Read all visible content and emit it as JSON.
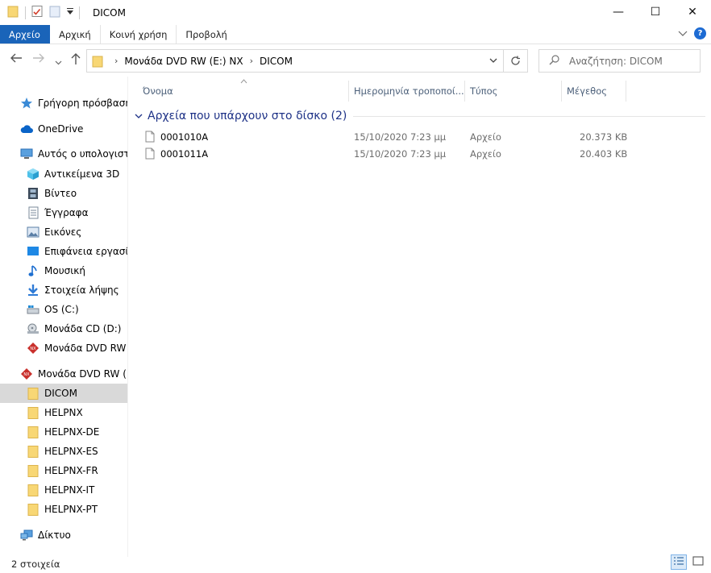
{
  "window": {
    "title": "DICOM",
    "controls": {
      "minimize": "—",
      "maximize": "☐",
      "close": "✕"
    }
  },
  "ribbon": {
    "tabs": [
      {
        "label": "Αρχείο",
        "active": true
      },
      {
        "label": "Αρχική"
      },
      {
        "label": "Κοινή χρήση"
      },
      {
        "label": "Προβολή"
      }
    ],
    "help": "?"
  },
  "nav": {
    "breadcrumb": [
      "Μονάδα DVD RW (E:) NX",
      "DICOM"
    ],
    "search_placeholder": "Αναζήτηση: DICOM"
  },
  "sidebar": {
    "items": [
      {
        "label": "Γρήγορη πρόσβαση",
        "icon": "star-icon",
        "level": 0
      },
      {
        "label": "OneDrive",
        "icon": "cloud-icon",
        "level": 0
      },
      {
        "label": "Αυτός ο υπολογιστής",
        "icon": "computer-icon",
        "level": 0
      },
      {
        "label": "Αντικείμενα 3D",
        "icon": "cube-3d-icon",
        "level": 1
      },
      {
        "label": "Βίντεο",
        "icon": "video-icon",
        "level": 1
      },
      {
        "label": "Έγγραφα",
        "icon": "document-icon",
        "level": 1
      },
      {
        "label": "Εικόνες",
        "icon": "pictures-icon",
        "level": 1
      },
      {
        "label": "Επιφάνεια εργασίας",
        "icon": "desktop-icon",
        "level": 1
      },
      {
        "label": "Μουσική",
        "icon": "music-icon",
        "level": 1
      },
      {
        "label": "Στοιχεία λήψης",
        "icon": "download-icon",
        "level": 1
      },
      {
        "label": "OS (C:)",
        "icon": "hard-drive-icon",
        "level": 1
      },
      {
        "label": "Μονάδα CD (D:)",
        "icon": "cd-drive-icon",
        "level": 1
      },
      {
        "label": "Μονάδα DVD RW (E:",
        "icon": "dvd-drive-icon",
        "level": 1
      },
      {
        "label": "Μονάδα DVD RW (E:)",
        "icon": "dvd-drive-icon",
        "level": 0
      },
      {
        "label": "DICOM",
        "icon": "folder-icon",
        "level": 1,
        "selected": true
      },
      {
        "label": "HELPNX",
        "icon": "folder-icon",
        "level": 1
      },
      {
        "label": "HELPNX-DE",
        "icon": "folder-icon",
        "level": 1
      },
      {
        "label": "HELPNX-ES",
        "icon": "folder-icon",
        "level": 1
      },
      {
        "label": "HELPNX-FR",
        "icon": "folder-icon",
        "level": 1
      },
      {
        "label": "HELPNX-IT",
        "icon": "folder-icon",
        "level": 1
      },
      {
        "label": "HELPNX-PT",
        "icon": "folder-icon",
        "level": 1
      },
      {
        "label": "Δίκτυο",
        "icon": "network-icon",
        "level": 0
      }
    ]
  },
  "content": {
    "columns": [
      "Όνομα",
      "Ημερομηνία τροποποί...",
      "Τύπος",
      "Μέγεθος"
    ],
    "group_title": "Αρχεία που υπάρχουν στο δίσκο (2)",
    "files": [
      {
        "name": "0001010A",
        "date": "15/10/2020 7:23 μμ",
        "type": "Αρχείο",
        "size": "20.373 KB"
      },
      {
        "name": "0001011A",
        "date": "15/10/2020 7:23 μμ",
        "type": "Αρχείο",
        "size": "20.403 KB"
      }
    ]
  },
  "status": {
    "count": "2 στοιχεία"
  },
  "colors": {
    "accent": "#1a64b9",
    "group_title": "#1e3287",
    "column_header": "#4c607a",
    "selected_bg": "#d9d9d9",
    "folder": "#f8d775"
  }
}
